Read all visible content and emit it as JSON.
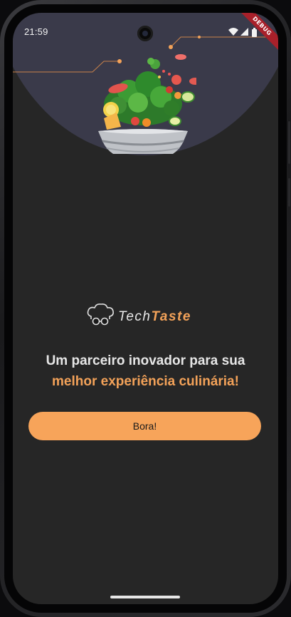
{
  "status_bar": {
    "time": "21:59",
    "debug_banner": "DEBUG",
    "icons": [
      "wifi-icon",
      "cellular-signal-icon",
      "battery-icon"
    ]
  },
  "hero": {
    "image": "salad-bowl-illustration"
  },
  "logo": {
    "icon": "chef-hat-glasses-icon",
    "part1": "Tech",
    "part2": "Taste"
  },
  "headline": {
    "line1": "Um parceiro inovador para sua",
    "line2": "melhor experiência culinária!"
  },
  "cta": {
    "label": "Bora!"
  },
  "colors": {
    "background": "#262626",
    "hero_arc": "#3a3a4a",
    "accent": "#f3a259",
    "button": "#f7a45a",
    "text_light": "#e6e6e6"
  }
}
